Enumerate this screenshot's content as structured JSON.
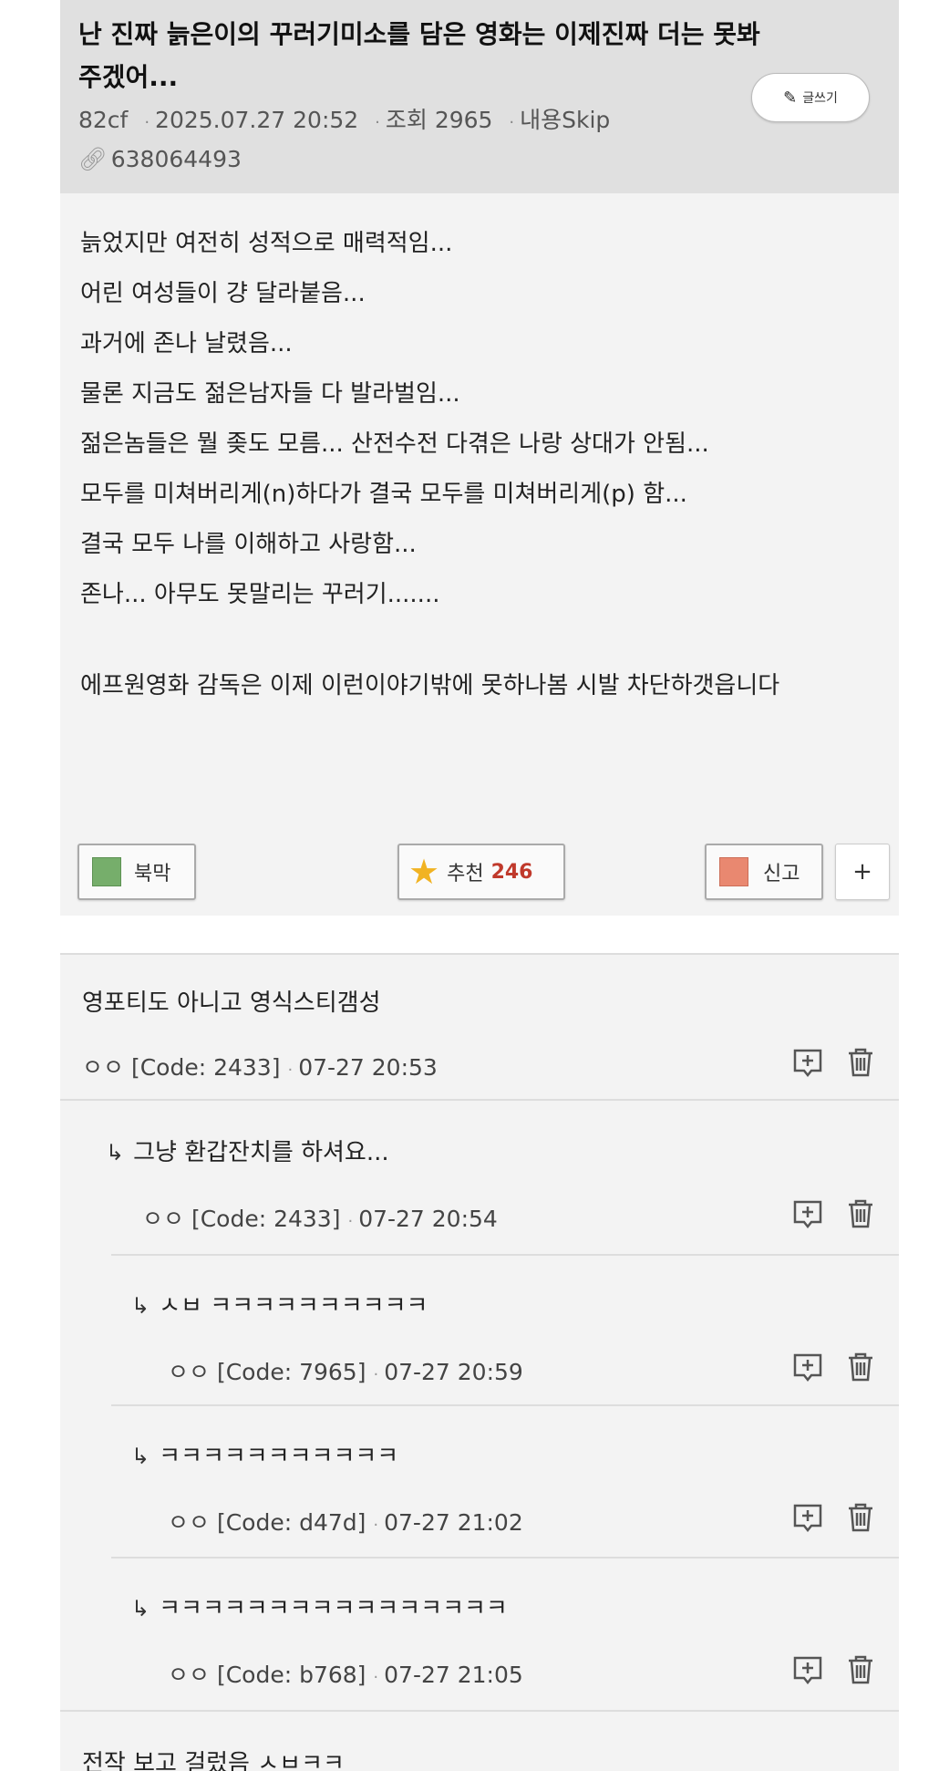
{
  "post": {
    "title": "난 진짜 늙은이의 꾸러기미소를 담은 영화는 이제진짜 더는 못봐주겠어...",
    "author": "82cf",
    "datetime": "2025.07.27 20:52",
    "views": "조회 2965",
    "skip": "내용Skip",
    "link_id": "638064493",
    "write_label": "글쓰기",
    "body_lines": [
      "늙었지만 여전히 성적으로 매력적임...",
      "어린 여성들이 걍 달라붙음...",
      "과거에 존나 날렸음...",
      "물론 지금도 젊은남자들 다 발라벌임...",
      "젊은놈들은 뭘 좆도 모름... 산전수전 다겪은 나랑 상대가 안됨...",
      "모두를 미쳐버리게(n)하다가 결국 모두를 미쳐버리게(p) 함...",
      "결국 모두 나를 이해하고 사랑함...",
      "존나... 아무도 못말리는 꾸러기......."
    ],
    "body_para": "에프원영화 감독은 이제 이런이야기밖에 못하나봄 시발 차단하갯읍니다",
    "bookmark_label": "북막",
    "recommend_label": "추천",
    "recommend_count": "246",
    "report_label": "신고",
    "plus_label": "+"
  },
  "comments": [
    {
      "text": "영포티도 아니고 영식스티갬성",
      "author": "ㅇㅇ [Code: 2433]",
      "time": "07-27 20:53"
    },
    {
      "text": "그냥 환갑잔치를 하셔요...",
      "author": "ㅇㅇ [Code: 2433]",
      "time": "07-27 20:54"
    },
    {
      "text": "ㅅㅂ ㅋㅋㅋㅋㅋㅋㅋㅋㅋㅋ",
      "author": "ㅇㅇ [Code: 7965]",
      "time": "07-27 20:59"
    },
    {
      "text": "ㅋㅋㅋㅋㅋㅋㅋㅋㅋㅋㅋ",
      "author": "ㅇㅇ [Code: d47d]",
      "time": "07-27 21:02"
    },
    {
      "text": "ㅋㅋㅋㅋㅋㅋㅋㅋㅋㅋㅋㅋㅋㅋㅋㅋ",
      "author": "ㅇㅇ [Code: b768]",
      "time": "07-27 21:05"
    },
    {
      "text": "전작 보고 걸렀음 ㅅㅂㅋㅋ"
    }
  ],
  "icons": {
    "reply": "reply-comment-icon",
    "delete": "trash-icon",
    "nested": "reply-arrow-icon",
    "link": "link-icon",
    "pencil": "pencil-icon"
  }
}
